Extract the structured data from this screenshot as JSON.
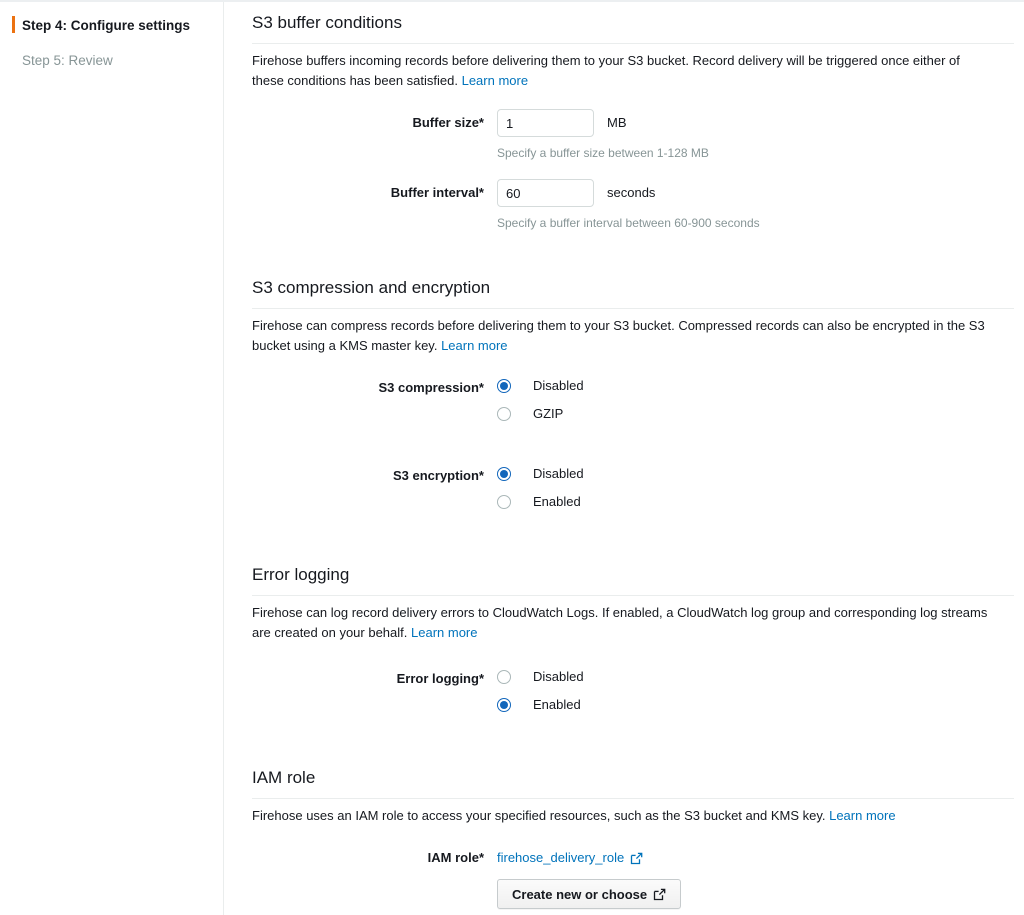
{
  "sidebar": {
    "steps": [
      {
        "label": "Step 4: Configure settings",
        "state": "active"
      },
      {
        "label": "Step 5: Review",
        "state": "inactive"
      }
    ]
  },
  "sections": {
    "buffer": {
      "title": "S3 buffer conditions",
      "description": "Firehose buffers incoming records before delivering them to your S3 bucket. Record delivery will be triggered once either of these conditions has been satisfied. ",
      "learn_more": "Learn more",
      "buffer_size": {
        "label": "Buffer size*",
        "value": "1",
        "placeholder": "",
        "unit": "MB",
        "hint": "Specify a buffer size between 1-128 MB"
      },
      "buffer_interval": {
        "label": "Buffer interval*",
        "value": "60",
        "placeholder": "",
        "unit": "seconds",
        "hint": "Specify a buffer interval between 60-900 seconds"
      }
    },
    "compression": {
      "title": "S3 compression and encryption",
      "description": "Firehose can compress records before delivering them to your S3 bucket. Compressed records can also be encrypted in the S3 bucket using a KMS master key. ",
      "learn_more": "Learn more",
      "s3_compression": {
        "label": "S3 compression*",
        "options": [
          {
            "label": "Disabled",
            "selected": true
          },
          {
            "label": "GZIP",
            "selected": false
          }
        ]
      },
      "s3_encryption": {
        "label": "S3 encryption*",
        "options": [
          {
            "label": "Disabled",
            "selected": true
          },
          {
            "label": "Enabled",
            "selected": false
          }
        ]
      }
    },
    "error_logging": {
      "title": "Error logging",
      "description": "Firehose can log record delivery errors to CloudWatch Logs. If enabled, a CloudWatch log group and corresponding log streams are created on your behalf. ",
      "learn_more": "Learn more",
      "error_logging_field": {
        "label": "Error logging*",
        "options": [
          {
            "label": "Disabled",
            "selected": false
          },
          {
            "label": "Enabled",
            "selected": true
          }
        ]
      }
    },
    "iam": {
      "title": "IAM role",
      "description": "Firehose uses an IAM role to access your specified resources, such as the S3 bucket and KMS key. ",
      "learn_more": "Learn more",
      "iam_role": {
        "label": "IAM role*",
        "role_name": "firehose_delivery_role",
        "button_label": "Create new or choose"
      }
    }
  },
  "colors": {
    "accent_orange": "#ec7211",
    "link_blue": "#0073bb",
    "radio_blue": "#1166bb",
    "text": "#16191f",
    "muted": "#879596",
    "border": "#eaeded"
  }
}
